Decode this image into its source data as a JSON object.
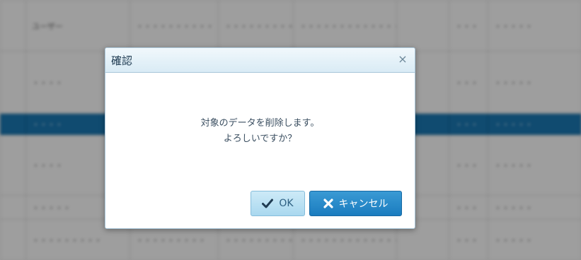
{
  "dialog": {
    "title": "確認",
    "close_label": "×",
    "message_line1": "対象のデータを削除します。",
    "message_line2": "よろしいですか？",
    "ok_label": "OK",
    "cancel_label": "キャンセル"
  },
  "background_table": {
    "rows": [
      [
        "ユーザー",
        "・・・・・・・・・・",
        "・・・・・・・・・",
        "・・・・・・・・・・・・・・・・",
        "",
        "・・・",
        "・・・・・"
      ],
      [
        "・・・・",
        "",
        "",
        "",
        "",
        "・・・",
        "・・・・・"
      ],
      [
        "・・・・",
        "",
        "",
        "",
        "",
        "・・・",
        "・・・・・"
      ],
      [
        "・・・・",
        "",
        "",
        "",
        "",
        "・・・",
        "・・・・・"
      ],
      [
        "・・・・・",
        "",
        "",
        "",
        "",
        "・・・",
        "・・・・・"
      ],
      [
        "・・・・・・・・・",
        "・・・・・・・・・",
        "・・・・・・・・・",
        "・・・・・・・・・・・・・",
        "",
        "・・・",
        "・・・・・"
      ]
    ]
  },
  "colors": {
    "selected_row": "#1a79b5",
    "ok_button": "#a9d8ef",
    "cancel_button": "#1a7cbf"
  }
}
